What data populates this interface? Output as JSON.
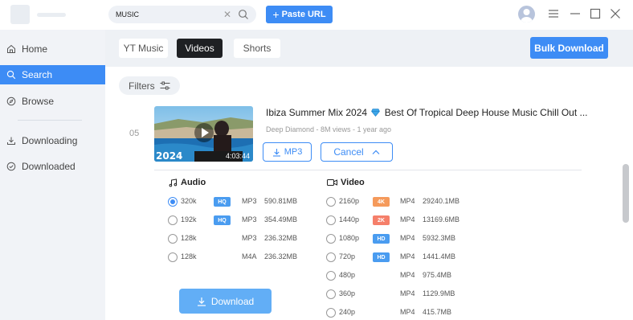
{
  "search": {
    "value": "MUSIC"
  },
  "header": {
    "paste_label": "Paste URL"
  },
  "sidebar": {
    "items": [
      {
        "label": "Home"
      },
      {
        "label": "Search"
      },
      {
        "label": "Browse"
      },
      {
        "label": "Downloading"
      },
      {
        "label": "Downloaded"
      }
    ]
  },
  "tabs": [
    {
      "label": "YT Music"
    },
    {
      "label": "Videos"
    },
    {
      "label": "Shorts"
    }
  ],
  "toolbar": {
    "bulk_label": "Bulk Download",
    "filters_label": "Filters"
  },
  "video": {
    "index": "05",
    "title_part1": "Ibiza Summer Mix 2024",
    "title_part2": "Best Of Tropical Deep House Music Chill Out ...",
    "meta": "Deep Diamond - 8M views - 1 year ago",
    "duration": "4:03:44",
    "thumb_year": "2024",
    "format_label": "MP3",
    "cancel_label": "Cancel"
  },
  "audio": {
    "heading": "Audio",
    "options": [
      {
        "quality": "320k",
        "badge": "HQ",
        "format": "MP3",
        "size": "590.81MB",
        "selected": true
      },
      {
        "quality": "192k",
        "badge": "HQ",
        "format": "MP3",
        "size": "354.49MB",
        "selected": false
      },
      {
        "quality": "128k",
        "badge": "",
        "format": "MP3",
        "size": "236.32MB",
        "selected": false
      },
      {
        "quality": "128k",
        "badge": "",
        "format": "M4A",
        "size": "236.32MB",
        "selected": false
      }
    ]
  },
  "video_opts": {
    "heading": "Video",
    "options": [
      {
        "quality": "2160p",
        "badge": "4K",
        "format": "MP4",
        "size": "29240.1MB"
      },
      {
        "quality": "1440p",
        "badge": "2K",
        "format": "MP4",
        "size": "13169.6MB"
      },
      {
        "quality": "1080p",
        "badge": "HD",
        "format": "MP4",
        "size": "5932.3MB"
      },
      {
        "quality": "720p",
        "badge": "HD",
        "format": "MP4",
        "size": "1441.4MB"
      },
      {
        "quality": "480p",
        "badge": "",
        "format": "MP4",
        "size": "975.4MB"
      },
      {
        "quality": "360p",
        "badge": "",
        "format": "MP4",
        "size": "1129.9MB"
      },
      {
        "quality": "240p",
        "badge": "",
        "format": "MP4",
        "size": "415.7MB"
      }
    ]
  },
  "download_label": "Download",
  "colors": {
    "accent": "#3d8cf5",
    "badge_hq": "#4a9cf0",
    "badge_4k": "#f59a5b",
    "badge_2k": "#f57f6a",
    "badge_hd": "#4a9cf0"
  }
}
